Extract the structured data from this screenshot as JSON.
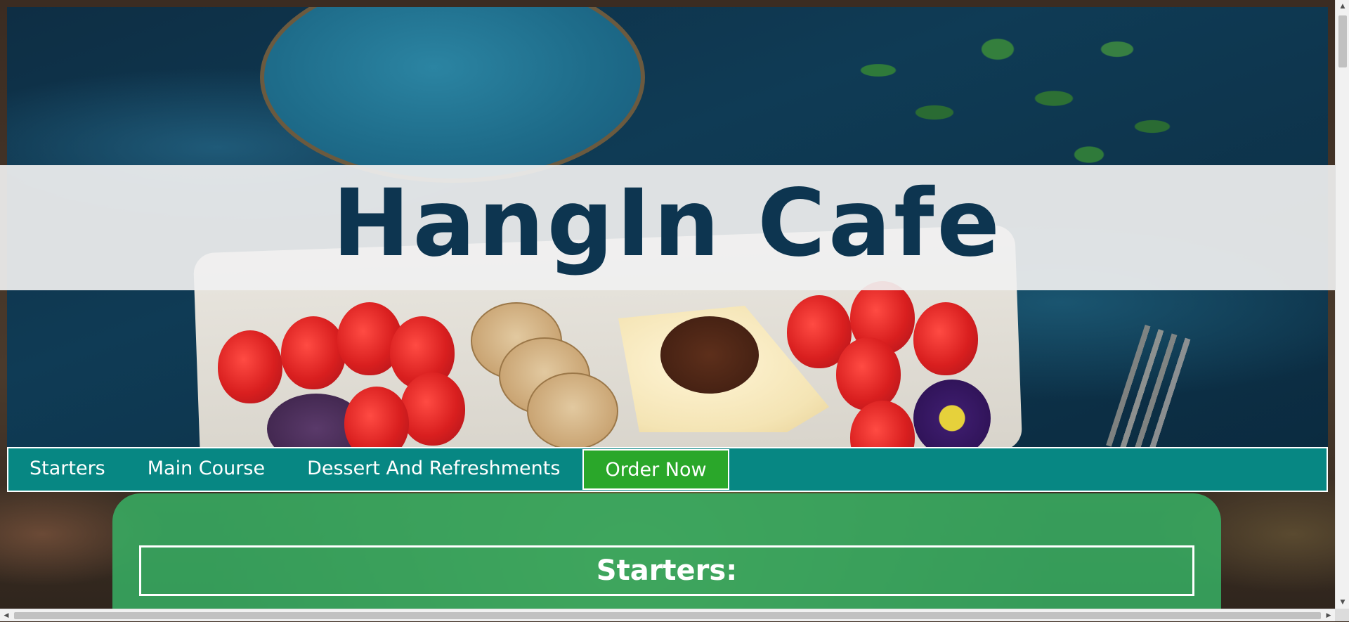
{
  "site": {
    "title": "HangIn Cafe"
  },
  "nav": {
    "items": [
      {
        "label": "Starters"
      },
      {
        "label": "Main Course"
      },
      {
        "label": "Dessert And Refreshments"
      }
    ],
    "order_label": "Order Now"
  },
  "section": {
    "title": "Starters:"
  },
  "icons": {
    "scroll_up": "arrow-up-icon",
    "scroll_down": "arrow-down-icon",
    "scroll_left": "arrow-left-icon",
    "scroll_right": "arrow-right-icon"
  },
  "colors": {
    "nav_background": "#078783",
    "order_button": "#2aa72a",
    "title_text": "#0d3550",
    "content_card": "#37b064"
  }
}
